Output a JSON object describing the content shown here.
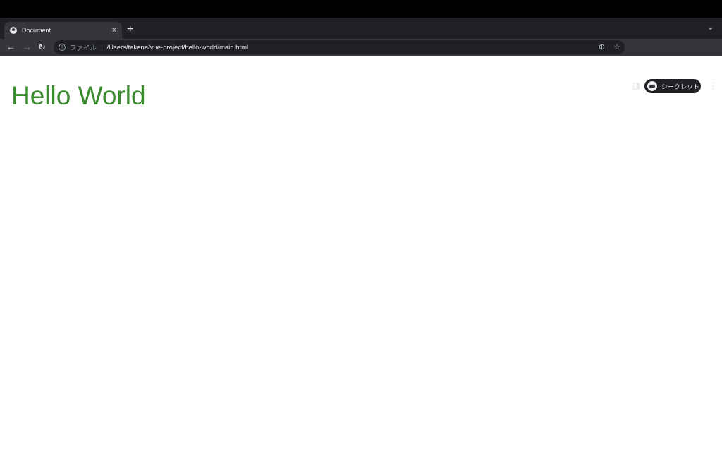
{
  "browser": {
    "tab": {
      "title": "Document",
      "close": "×"
    },
    "new_tab": "+",
    "tab_search": "⌄",
    "nav": {
      "back": "←",
      "forward": "→",
      "reload": "↻"
    },
    "address": {
      "scheme_label": "ファイル",
      "separator": "|",
      "url": "/Users/takana/vue-project/hello-world/main.html"
    },
    "zoom_icon": "⊕",
    "bookmark_icon": "☆",
    "profile_label": "シークレット",
    "menu": "⋮"
  },
  "page": {
    "heading": "Hello World",
    "heading_color": "#3a8a2e"
  }
}
